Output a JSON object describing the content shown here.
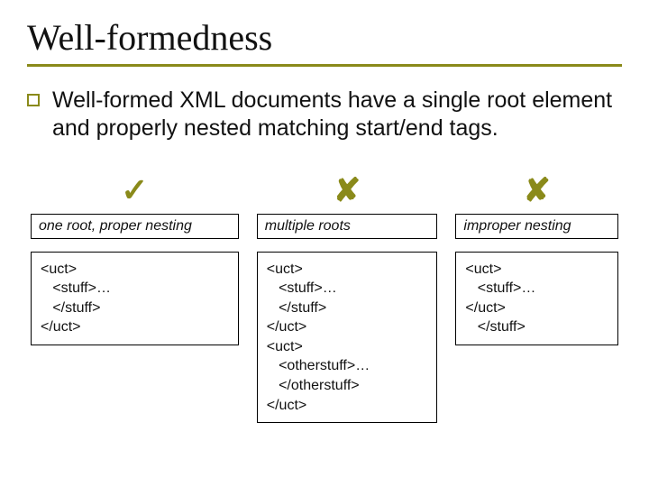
{
  "title": "Well-formedness",
  "body": "Well-formed XML documents have a single root element and properly nested matching start/end tags.",
  "columns": [
    {
      "mark": "✓",
      "label": "one root, proper nesting",
      "code": "<uct>\n   <stuff>…\n   </stuff>\n</uct>"
    },
    {
      "mark": "✘",
      "label": "multiple roots",
      "code": "<uct>\n   <stuff>…\n   </stuff>\n</uct>\n<uct>\n   <otherstuff>…\n   </otherstuff>\n</uct>"
    },
    {
      "mark": "✘",
      "label": "improper nesting",
      "code": "<uct>\n   <stuff>…\n</uct>\n   </stuff>"
    }
  ]
}
